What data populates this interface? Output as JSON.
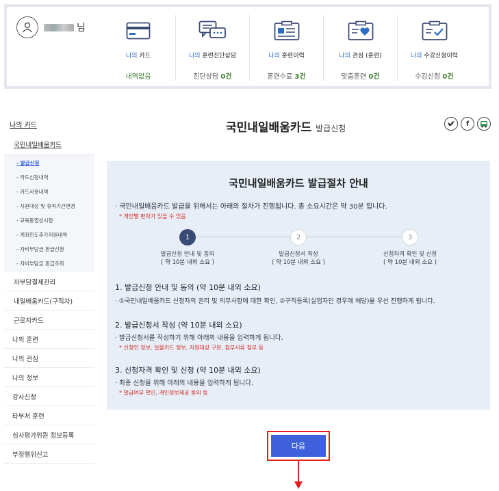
{
  "user": {
    "suffix": "님"
  },
  "stats": [
    {
      "prefix": "나의",
      "label": "카드",
      "value": "내역없음",
      "number": ""
    },
    {
      "prefix": "나의",
      "label": "훈련진단상담",
      "value": "진단상담",
      "number": "0건"
    },
    {
      "prefix": "나의",
      "label": "훈련이력",
      "value": "훈련수료",
      "number": "3건"
    },
    {
      "prefix": "나의",
      "label": "관심 (훈련)",
      "value": "맞춤훈련",
      "number": "0건"
    },
    {
      "prefix": "나의",
      "label": "수강신청이력",
      "value": "수강신청",
      "number": "0건"
    }
  ],
  "sidebar": {
    "top": "나의 카드",
    "sub": "국민내일배움카드",
    "items": [
      "- 발급신청",
      "- 카드신청내역",
      "- 카드사용내역",
      "- 지원대상 및 휴직기간변경",
      "- 교육동영상시청",
      "- 계좌한도추가지원내역",
      "- 자비부담금 환급신청",
      "- 자비부담금 환급조회"
    ],
    "sections": [
      "자부담결제관리",
      "내일배움카드(구직자)",
      "근로자카드"
    ],
    "menus": [
      "나의 훈련",
      "나의 관심",
      "나의 정보",
      "강사신청",
      "타부처 훈련",
      "심사평가위원 정보등록",
      "부정행위신고"
    ]
  },
  "page": {
    "title": "국민내일배움카드",
    "subtitle": "발급신청"
  },
  "share": {
    "twitter": "twitter-icon",
    "facebook": "facebook-icon",
    "bus": "bus-icon"
  },
  "guide": {
    "title": "국민내일배움카드 발급절차 안내",
    "intro": "· 국민내일배움카드 발급을 위해서는 아래의 절차가 진행됩니다. 총 소요시간은 약 30분 입니다.",
    "intro_note": "* 개인별 편차가 있을 수 있음",
    "steps": [
      {
        "num": "1",
        "label": "발급신청 안내 및 동의",
        "time": "( 약 10분 내외 소요 )"
      },
      {
        "num": "2",
        "label": "발급신청서 작성",
        "time": "( 약 10분 내외 소요 )"
      },
      {
        "num": "3",
        "label": "신청자격 확인 및 신청",
        "time": "( 약 10분 내외 소요 )"
      }
    ],
    "sections": [
      {
        "title": "1. 발급신청 안내 및 동의 (약 10분 내외 소요)",
        "desc": "· ①국민내일배움카드 신청자의 권리 및 의무사항에 대한 확인, ②구직등록(실업자인 경우에 해당)을 우선 진행하게 됩니다.",
        "note": ""
      },
      {
        "title": "2. 발급신청서 작성 (약 10분 내외 소요)",
        "desc": "· 발급신청서를 작성하기 위해 아래의 내용을 입력하게 됩니다.",
        "note": "* 신청인 정보, 실물카드 정보, 지원대상 구분, 첨부서류 첨부 등"
      },
      {
        "title": "3. 신청자격 확인 및 신청 (약 10분 내외 소요)",
        "desc": "· 최종 신청을 위해 아래의 내용을 입력하게 됩니다.",
        "note": "* 발급여부 확인, 개인정보제공 동의 등"
      }
    ]
  },
  "next_label": "다음",
  "colors": {
    "accent": "#3e61db",
    "highlight": "#e41e1e",
    "step_active": "#3a4a76",
    "panel_bg": "#e7eef8"
  }
}
